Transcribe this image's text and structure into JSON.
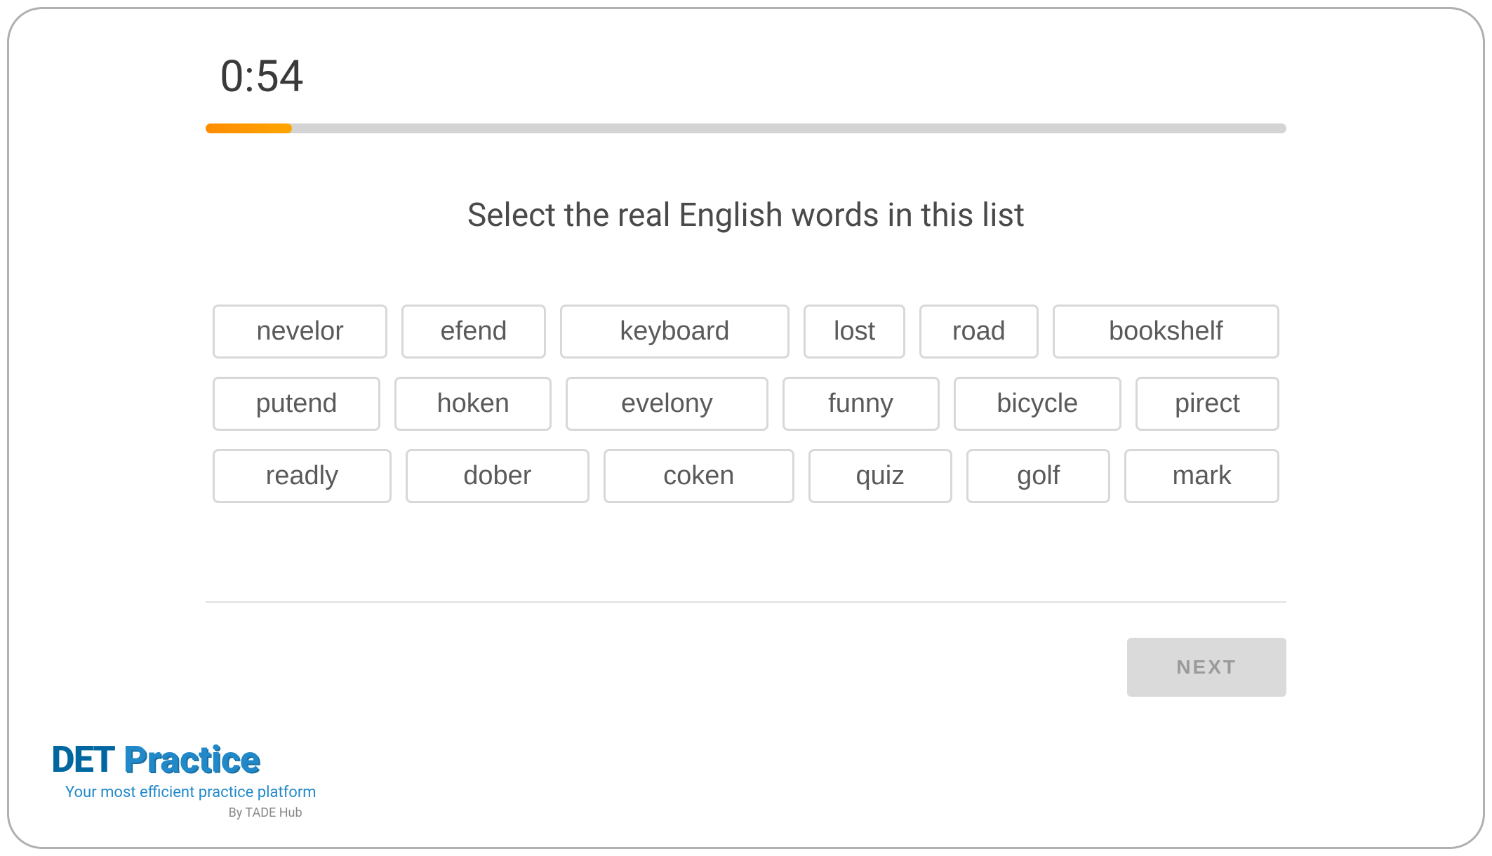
{
  "timer": "0:54",
  "progress_percent": 8,
  "instruction": "Select the real English words in this list",
  "rows": [
    [
      "nevelor",
      "efend",
      "keyboard",
      "lost",
      "road",
      "bookshelf"
    ],
    [
      "putend",
      "hoken",
      "evelony",
      "funny",
      "bicycle",
      "pirect"
    ],
    [
      "readly",
      "dober",
      "coken",
      "quiz",
      "golf",
      "mark"
    ]
  ],
  "next_button": "NEXT",
  "branding": {
    "det": "DET",
    "practice": "Practice",
    "tagline": "Your most efficient practice platform",
    "by": "By TADE Hub"
  }
}
